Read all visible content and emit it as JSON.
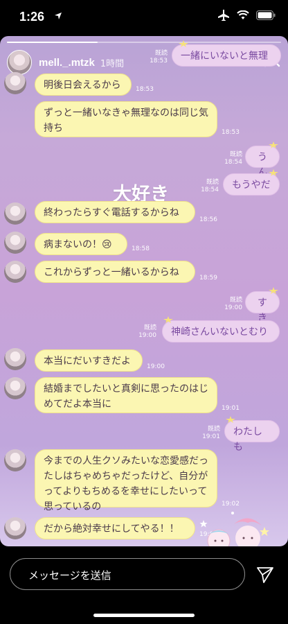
{
  "status_bar": {
    "time": "1:26"
  },
  "story": {
    "username": "mell._.mtzk",
    "time_ago": "1時間",
    "overlay_text": "大好き",
    "progress_fraction": 0.33
  },
  "messages": [
    {
      "side": "right",
      "text": "一緒にいないと無理",
      "read": "既読",
      "time": "18:53"
    },
    {
      "side": "left",
      "text": "明後日会えるから",
      "time": "18:53"
    },
    {
      "side": "left",
      "text": "ずっと一緒いなきゃ無理なのは同じ気持ち",
      "time": "18:53"
    },
    {
      "side": "right",
      "text": "うん",
      "read": "既読",
      "time": "18:54"
    },
    {
      "side": "right",
      "text": "もうやだ",
      "read": "既読",
      "time": "18:54"
    },
    {
      "side": "left",
      "text": "終わったらすぐ電話するからね",
      "time": "18:56"
    },
    {
      "side": "left",
      "text": "病まないの！😢",
      "time": "18:58"
    },
    {
      "side": "left",
      "text": "これからずっと一緒いるからね",
      "time": "18:59"
    },
    {
      "side": "right",
      "text": "すき",
      "read": "既読",
      "time": "19:00"
    },
    {
      "side": "right",
      "text": "神崎さんいないとむり",
      "read": "既読",
      "time": "19:00"
    },
    {
      "side": "left",
      "text": "本当にだいすきだよ",
      "time": "19:00"
    },
    {
      "side": "left",
      "text": "結婚までしたいと真剣に思ったのはじめてだよ本当に",
      "time": "19:01"
    },
    {
      "side": "right",
      "text": "わたしも",
      "read": "既読",
      "time": "19:01"
    },
    {
      "side": "left",
      "text": "今までの人生クソみたいな恋愛感だったしはちゃめちゃだったけど、自分がってよりもちめるを幸せにしたいって思っているの",
      "time": "19:02"
    },
    {
      "side": "left",
      "text": "だから絶対幸せにしてやる！！",
      "time": "19:03"
    }
  ],
  "reply": {
    "placeholder": "メッセージを送信"
  },
  "icons": {
    "close": "close-icon",
    "more": "more-icon",
    "send": "send-icon",
    "location": "location-arrow-icon",
    "airplane": "airplane-icon",
    "wifi": "wifi-icon",
    "battery": "battery-icon"
  }
}
